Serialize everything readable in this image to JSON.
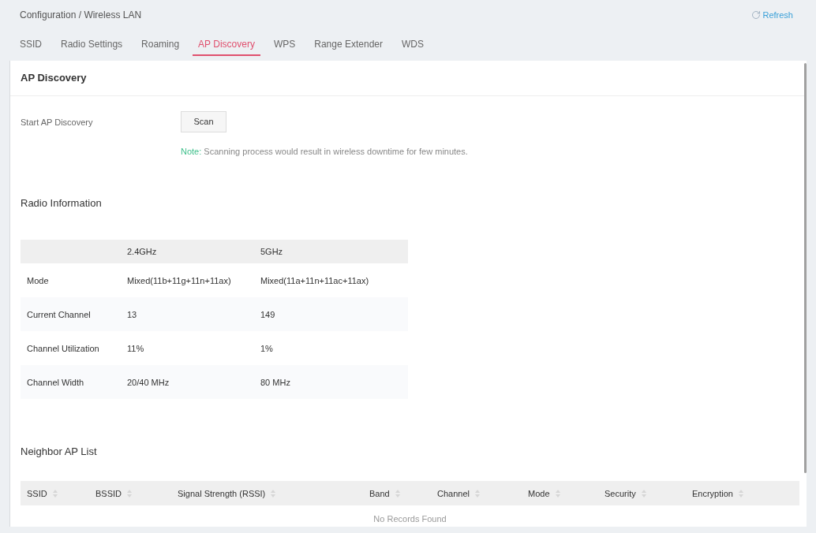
{
  "breadcrumb": "Configuration / Wireless LAN",
  "refresh_button": {
    "label": "Refresh"
  },
  "tabs": [
    {
      "label": "SSID",
      "selected": false
    },
    {
      "label": "Radio Settings",
      "selected": false
    },
    {
      "label": "Roaming",
      "selected": false
    },
    {
      "label": "AP Discovery",
      "selected": true
    },
    {
      "label": "WPS",
      "selected": false
    },
    {
      "label": "Range Extender",
      "selected": false
    },
    {
      "label": "WDS",
      "selected": false
    }
  ],
  "panel": {
    "title": "AP Discovery",
    "start_discovery": {
      "label": "Start AP Discovery",
      "button": "Scan"
    },
    "note": {
      "label": "Note:",
      "text": "Scanning process would result in wireless downtime for few minutes."
    }
  },
  "radio_information": {
    "title": "Radio Information",
    "columns": [
      "2.4GHz",
      "5GHz"
    ],
    "rows": [
      {
        "label": "Mode",
        "values": [
          "Mixed(11b+11g+11n+11ax)",
          "Mixed(11a+11n+11ac+11ax)"
        ]
      },
      {
        "label": "Current Channel",
        "values": [
          "13",
          "149"
        ]
      },
      {
        "label": "Channel Utilization",
        "values": [
          "11%",
          "1%"
        ]
      },
      {
        "label": "Channel Width",
        "values": [
          "20/40 MHz",
          "80 MHz"
        ]
      }
    ]
  },
  "neighbor_ap_list": {
    "title": "Neighbor AP List",
    "columns": [
      "SSID",
      "BSSID",
      "Signal Strength (RSSI)",
      "Band",
      "Channel",
      "Mode",
      "Security",
      "Encryption"
    ],
    "empty_message": "No Records Found"
  }
}
